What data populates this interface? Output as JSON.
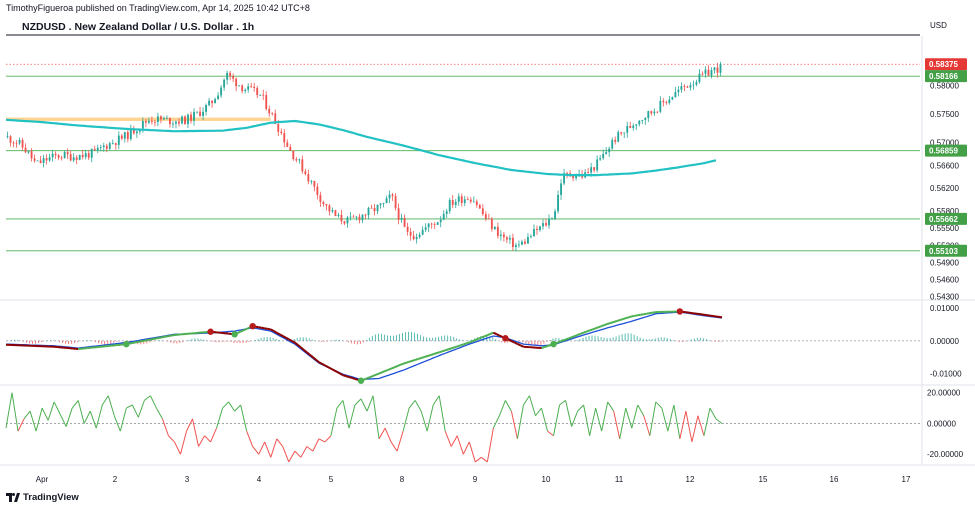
{
  "header": {
    "publisher": "TimothyFigueroa published on TradingView.com, Apr 14, 2025 10:42 UTC+8",
    "title": "NZDUSD . New Zealand Dollar / U.S. Dollar . 1h",
    "currency": "USD"
  },
  "footer": {
    "brand": "TradingView"
  },
  "colors": {
    "up": "#26a69a",
    "down": "#ef5350",
    "ema": "#22c1c3",
    "hline": "#4caf50",
    "zone": "#ffcc80",
    "macd_fast": "#1e4fd8",
    "macd_signal_up": "#4caf50",
    "macd_signal_down": "#8b0000",
    "rsi_up": "#4caf50",
    "rsi_down": "#ef5350"
  },
  "chart_data": [
    {
      "type": "candlestick",
      "name": "price",
      "symbol": "NZDUSD",
      "interval": "1h",
      "x_labels": [
        "Apr",
        "2",
        "3",
        "4",
        "5",
        "8",
        "9",
        "10",
        "11",
        "12",
        "15",
        "16",
        "17"
      ],
      "y_ticks": [
        "0.58000",
        "0.57500",
        "0.57000",
        "0.56600",
        "0.56200",
        "0.55800",
        "0.55500",
        "0.55200",
        "0.54900",
        "0.54600",
        "0.54300"
      ],
      "y_range": [
        0.5424,
        0.5887
      ],
      "current_price": "0.58375",
      "horizontal_levels": [
        "0.58166",
        "0.56859",
        "0.55662",
        "0.55103"
      ],
      "zone": [
        0.5738,
        0.5744
      ],
      "moving_average": {
        "color": "#22c1c3",
        "points": [
          [
            0,
            0.574
          ],
          [
            3,
            0.5736
          ],
          [
            6,
            0.573
          ],
          [
            10,
            0.5724
          ],
          [
            14,
            0.572
          ],
          [
            18,
            0.5721
          ],
          [
            20,
            0.5726
          ],
          [
            22,
            0.5735
          ],
          [
            24,
            0.5738
          ],
          [
            26,
            0.5732
          ],
          [
            28,
            0.5722
          ],
          [
            30,
            0.571
          ],
          [
            33,
            0.5695
          ],
          [
            36,
            0.5678
          ],
          [
            39,
            0.5664
          ],
          [
            42,
            0.5652
          ],
          [
            45,
            0.5645
          ],
          [
            47,
            0.5643
          ],
          [
            49,
            0.5643
          ],
          [
            52,
            0.5646
          ],
          [
            54,
            0.5651
          ],
          [
            56,
            0.5657
          ],
          [
            58,
            0.5664
          ],
          [
            59,
            0.5669
          ]
        ]
      },
      "ohlc_path": [
        [
          0,
          0.571
        ],
        [
          1,
          0.57
        ],
        [
          1.8,
          0.5683
        ],
        [
          2.5,
          0.5662
        ],
        [
          3.5,
          0.5672
        ],
        [
          4.5,
          0.5678
        ],
        [
          5.5,
          0.5676
        ],
        [
          6.5,
          0.5678
        ],
        [
          7.5,
          0.5683
        ],
        [
          8,
          0.5692
        ],
        [
          9,
          0.5702
        ],
        [
          10,
          0.5712
        ],
        [
          11,
          0.5728
        ],
        [
          12,
          0.5742
        ],
        [
          13,
          0.574
        ],
        [
          14,
          0.5738
        ],
        [
          15,
          0.574
        ],
        [
          16,
          0.5752
        ],
        [
          17,
          0.5768
        ],
        [
          17.8,
          0.5795
        ],
        [
          18.3,
          0.582
        ],
        [
          19,
          0.5808
        ],
        [
          19.8,
          0.5795
        ],
        [
          20.5,
          0.579
        ],
        [
          21.2,
          0.5782
        ],
        [
          22,
          0.5752
        ],
        [
          22.8,
          0.572
        ],
        [
          23.5,
          0.569
        ],
        [
          24.5,
          0.566
        ],
        [
          25.5,
          0.5625
        ],
        [
          26.5,
          0.559
        ],
        [
          27.5,
          0.5568
        ],
        [
          28.5,
          0.5562
        ],
        [
          29.5,
          0.5572
        ],
        [
          30.5,
          0.5582
        ],
        [
          31.5,
          0.5592
        ],
        [
          32,
          0.5608
        ],
        [
          32.5,
          0.5578
        ],
        [
          33.3,
          0.554
        ],
        [
          34,
          0.5538
        ],
        [
          35,
          0.5552
        ],
        [
          36,
          0.5565
        ],
        [
          36.8,
          0.5592
        ],
        [
          37.5,
          0.56
        ],
        [
          38.5,
          0.5605
        ],
        [
          39,
          0.5598
        ],
        [
          39.5,
          0.5578
        ],
        [
          40.5,
          0.555
        ],
        [
          41.5,
          0.553
        ],
        [
          42.5,
          0.5518
        ],
        [
          43.3,
          0.553
        ],
        [
          44,
          0.5545
        ],
        [
          45,
          0.556
        ],
        [
          45.6,
          0.558
        ],
        [
          46.2,
          0.564
        ],
        [
          47,
          0.5645
        ],
        [
          48,
          0.5642
        ],
        [
          49,
          0.566
        ],
        [
          49.8,
          0.5682
        ],
        [
          50.5,
          0.5705
        ],
        [
          51.5,
          0.5722
        ],
        [
          52.5,
          0.574
        ],
        [
          53.5,
          0.5752
        ],
        [
          54.5,
          0.5768
        ],
        [
          55.5,
          0.5785
        ],
        [
          56.5,
          0.58
        ],
        [
          57.5,
          0.5812
        ],
        [
          58.5,
          0.5825
        ],
        [
          59.5,
          0.5833
        ]
      ]
    },
    {
      "type": "line",
      "name": "MACD",
      "y_ticks": [
        "0.01000",
        "0.00000",
        "-0.01000"
      ],
      "y_range": [
        -0.0135,
        0.0125
      ],
      "series": [
        {
          "color": "#1e4fd8",
          "points": [
            [
              0,
              -0.001
            ],
            [
              4,
              -0.0015
            ],
            [
              6,
              -0.0022
            ],
            [
              10,
              -0.0005
            ],
            [
              14,
              0.002
            ],
            [
              17,
              0.0024
            ],
            [
              19,
              0.003
            ],
            [
              20.5,
              0.004
            ],
            [
              22,
              0.003
            ],
            [
              24,
              -0.001
            ],
            [
              26,
              -0.0068
            ],
            [
              28,
              -0.0102
            ],
            [
              29.5,
              -0.0118
            ],
            [
              31,
              -0.0115
            ],
            [
              33,
              -0.009
            ],
            [
              36,
              -0.0045
            ],
            [
              38.5,
              -0.001
            ],
            [
              40.5,
              0.0015
            ],
            [
              41.5,
              0.001
            ],
            [
              43,
              -0.001
            ],
            [
              44.5,
              -0.0015
            ],
            [
              45.5,
              -0.0012
            ],
            [
              48,
              0.0018
            ],
            [
              50,
              0.004
            ],
            [
              52,
              0.006
            ],
            [
              54,
              0.0083
            ],
            [
              56,
              0.0088
            ],
            [
              58,
              0.0077
            ],
            [
              59.5,
              0.007
            ]
          ]
        },
        {
          "color": "#4caf50",
          "points": [
            [
              0,
              -0.0012
            ],
            [
              4,
              -0.0018
            ],
            [
              6,
              -0.0025
            ],
            [
              10,
              -0.001
            ],
            [
              14,
              0.0018
            ],
            [
              17,
              0.0028
            ],
            [
              19,
              0.002
            ],
            [
              20.5,
              0.0045
            ],
            [
              22,
              0.0035
            ],
            [
              24,
              -0.0005
            ],
            [
              26,
              -0.0065
            ],
            [
              28,
              -0.0105
            ],
            [
              29.5,
              -0.0122
            ],
            [
              31,
              -0.01
            ],
            [
              33,
              -0.007
            ],
            [
              36,
              -0.0035
            ],
            [
              38.5,
              -0.0005
            ],
            [
              40.5,
              0.0025
            ],
            [
              41.5,
              0.0008
            ],
            [
              43,
              -0.0018
            ],
            [
              44.5,
              -0.0022
            ],
            [
              45.5,
              -0.001
            ],
            [
              48,
              0.0025
            ],
            [
              50,
              0.0052
            ],
            [
              52,
              0.0075
            ],
            [
              54,
              0.0088
            ],
            [
              56,
              0.009
            ],
            [
              58,
              0.008
            ],
            [
              59.5,
              0.0072
            ]
          ]
        }
      ]
    },
    {
      "type": "line",
      "name": "Oscillator",
      "y_ticks": [
        "20.00000",
        "0.00000",
        "-20.00000"
      ],
      "y_range": [
        -27,
        25
      ],
      "series": [
        {
          "points": [
            [
              0,
              -3
            ],
            [
              0.5,
              20
            ],
            [
              1,
              -5
            ],
            [
              1.5,
              3
            ],
            [
              2,
              8
            ],
            [
              2.5,
              -5
            ],
            [
              3,
              10
            ],
            [
              3.5,
              2
            ],
            [
              4,
              14
            ],
            [
              4.5,
              6
            ],
            [
              5,
              -2
            ],
            [
              5.5,
              10
            ],
            [
              6,
              15
            ],
            [
              6.5,
              0
            ],
            [
              7,
              8
            ],
            [
              7.5,
              -3
            ],
            [
              8,
              12
            ],
            [
              8.5,
              18
            ],
            [
              9,
              5
            ],
            [
              9.5,
              -5
            ],
            [
              10,
              10
            ],
            [
              10.5,
              12
            ],
            [
              11,
              4
            ],
            [
              11.5,
              15
            ],
            [
              12,
              18
            ],
            [
              12.5,
              10
            ],
            [
              13,
              3
            ],
            [
              13.5,
              -8
            ],
            [
              14,
              -12
            ],
            [
              14.5,
              -20
            ],
            [
              15,
              -5
            ],
            [
              15.5,
              3
            ],
            [
              16,
              -15
            ],
            [
              16.5,
              -8
            ],
            [
              17,
              -12
            ],
            [
              17.5,
              -3
            ],
            [
              18,
              10
            ],
            [
              18.5,
              14
            ],
            [
              19,
              8
            ],
            [
              19.5,
              12
            ],
            [
              20,
              -5
            ],
            [
              20.5,
              -15
            ],
            [
              21,
              -20
            ],
            [
              21.5,
              -12
            ],
            [
              22,
              -22
            ],
            [
              22.5,
              -10
            ],
            [
              23,
              -15
            ],
            [
              23.5,
              -25
            ],
            [
              24,
              -18
            ],
            [
              24.5,
              -22
            ],
            [
              25,
              -15
            ],
            [
              25.5,
              -18
            ],
            [
              26,
              -10
            ],
            [
              26.5,
              -12
            ],
            [
              27,
              -8
            ],
            [
              27.5,
              10
            ],
            [
              28,
              15
            ],
            [
              28.5,
              -3
            ],
            [
              29,
              12
            ],
            [
              29.5,
              16
            ],
            [
              30,
              8
            ],
            [
              30.5,
              18
            ],
            [
              31,
              -10
            ],
            [
              31.5,
              -3
            ],
            [
              32,
              -12
            ],
            [
              32.5,
              -18
            ],
            [
              33,
              -5
            ],
            [
              33.5,
              10
            ],
            [
              34,
              15
            ],
            [
              34.5,
              8
            ],
            [
              35,
              -5
            ],
            [
              35.5,
              12
            ],
            [
              36,
              18
            ],
            [
              36.5,
              -5
            ],
            [
              37,
              -15
            ],
            [
              37.5,
              -8
            ],
            [
              38,
              -20
            ],
            [
              38.5,
              -12
            ],
            [
              39,
              -25
            ],
            [
              39.5,
              -22
            ],
            [
              40,
              -25
            ],
            [
              40.5,
              -3
            ],
            [
              41,
              5
            ],
            [
              41.5,
              15
            ],
            [
              42,
              8
            ],
            [
              42.5,
              -10
            ],
            [
              43,
              12
            ],
            [
              43.5,
              18
            ],
            [
              44,
              5
            ],
            [
              44.5,
              10
            ],
            [
              45,
              -5
            ],
            [
              45.5,
              -8
            ],
            [
              46,
              12
            ],
            [
              46.5,
              15
            ],
            [
              47,
              -2
            ],
            [
              47.5,
              8
            ],
            [
              48,
              12
            ],
            [
              48.5,
              -8
            ],
            [
              49,
              10
            ],
            [
              49.5,
              -5
            ],
            [
              50,
              14
            ],
            [
              50.5,
              8
            ],
            [
              51,
              -10
            ],
            [
              51.5,
              10
            ],
            [
              52,
              -3
            ],
            [
              52.5,
              12
            ],
            [
              53,
              5
            ],
            [
              53.5,
              -8
            ],
            [
              54,
              14
            ],
            [
              54.5,
              10
            ],
            [
              55,
              -5
            ],
            [
              55.5,
              12
            ],
            [
              56,
              -10
            ],
            [
              56.5,
              8
            ],
            [
              57,
              -12
            ],
            [
              57.5,
              5
            ],
            [
              58,
              -8
            ],
            [
              58.5,
              10
            ],
            [
              59,
              3
            ],
            [
              59.5,
              0
            ]
          ]
        }
      ]
    }
  ]
}
